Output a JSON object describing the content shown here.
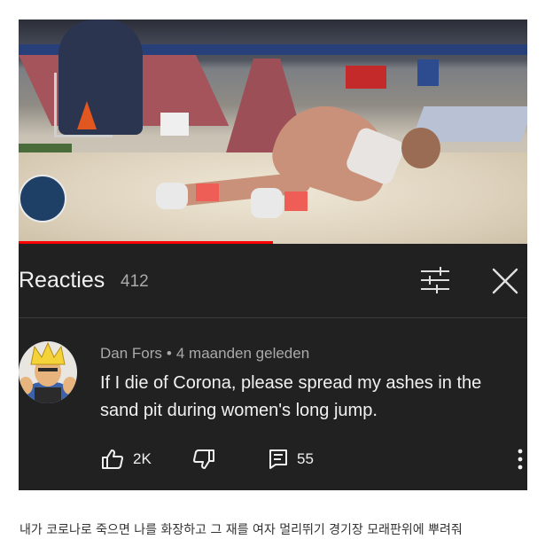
{
  "reactions": {
    "title": "Reacties",
    "count": "412"
  },
  "comment": {
    "author": "Dan Fors",
    "separator": "•",
    "time": "4 maanden geleden",
    "text": "If I die of Corona, please spread my ashes in the sand pit during women's long jump.",
    "likes": "2K",
    "replies": "55"
  },
  "icons": {
    "filter": "sliders-icon",
    "close": "close-icon",
    "like": "thumbs-up-icon",
    "dislike": "thumbs-down-icon",
    "replies": "comment-icon",
    "more": "more-vertical-icon"
  },
  "video": {
    "progress": 0.5
  },
  "caption": "내가 코로나로 죽으면 나를 화장하고 그 재를 여자 멀리뛰기 경기장 모래판위에 뿌려줘",
  "colors": {
    "panel_bg": "#212121",
    "text_primary": "#f1f1f1",
    "text_secondary": "#aaaaaa",
    "progress": "#ff0000"
  }
}
